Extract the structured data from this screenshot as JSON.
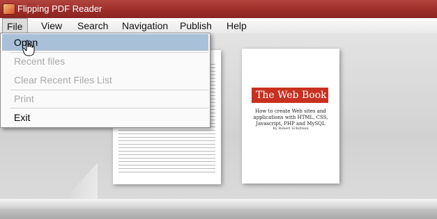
{
  "window": {
    "title": "Flipping PDF Reader"
  },
  "menubar": {
    "items": [
      {
        "label": "File"
      },
      {
        "label": "View"
      },
      {
        "label": "Search"
      },
      {
        "label": "Navigation"
      },
      {
        "label": "Publish"
      },
      {
        "label": "Help"
      }
    ]
  },
  "file_menu": {
    "open": "Open",
    "recent_files": "Recent files",
    "clear_recent": "Clear Recent Files List",
    "print": "Print",
    "exit": "Exit"
  },
  "book_right": {
    "title": "The Web Book",
    "subtitle": "How to create Web sites and applications with HTML, CSS, Javascript, PHP and MySQL",
    "author": "By Robert Schifreen"
  },
  "colors": {
    "titlebar": "#9d2e29",
    "highlight": "#a9c0d9",
    "cover_band": "#c8301f"
  }
}
